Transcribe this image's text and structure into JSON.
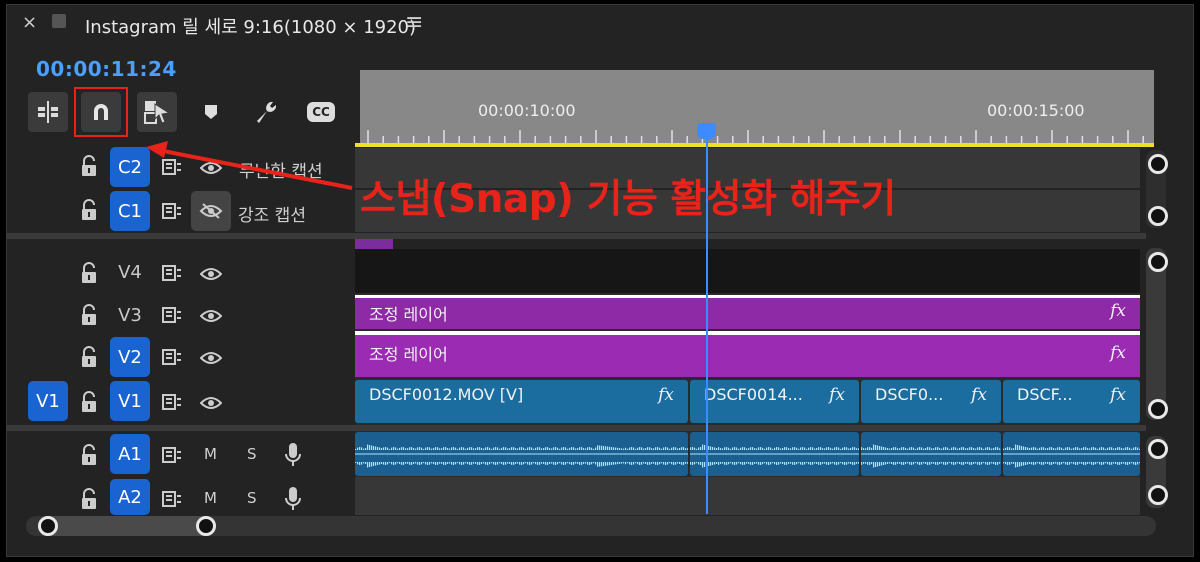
{
  "sequence": {
    "close_glyph": "×",
    "title": "Instagram 릴 세로 9:16(1080 × 1920)",
    "menu_glyph": "≡"
  },
  "timecode": "00:00:11:24",
  "ruler": {
    "labels": [
      "00:00:10:00",
      "00:00:15:00"
    ]
  },
  "toolbar": {
    "icons": [
      "insert-ripple-icon",
      "snap-magnet-icon",
      "linked-selection-icon",
      "marker-icon",
      "wrench-icon",
      "captions-icon"
    ],
    "captions_label": "CC"
  },
  "tracks": {
    "c2": {
      "id": "C2",
      "name": "무난한 캡션"
    },
    "c1": {
      "id": "C1",
      "name": "강조 캡션"
    },
    "v4": {
      "id": "V4"
    },
    "v3": {
      "id": "V3"
    },
    "v2": {
      "id": "V2"
    },
    "v1": {
      "id": "V1",
      "source": "V1"
    },
    "a1": {
      "id": "A1",
      "mute": "M",
      "solo": "S"
    },
    "a2": {
      "id": "A2",
      "mute": "M",
      "solo": "S"
    }
  },
  "clips": {
    "v3": {
      "label": "조정 레이어",
      "fx": "fx"
    },
    "v2": {
      "label": "조정 레이어",
      "fx": "fx"
    },
    "v1": [
      {
        "label": "DSCF0012.MOV [V]",
        "fx": "fx"
      },
      {
        "label": "DSCF0014...",
        "fx": "fx"
      },
      {
        "label": "DSCF0...",
        "fx": "fx"
      },
      {
        "label": "DSCF...",
        "fx": "fx"
      }
    ]
  },
  "annotation": {
    "text": "스냅(Snap) 기능 활성화 해주기",
    "color": "#e8231a"
  },
  "colors": {
    "accent_blue": "#1a64d2",
    "timecode_blue": "#4a9fff",
    "adjustment_purple": "#9b27b0",
    "video_clip_blue": "#1b6da0",
    "audio_clip_blue": "#1a5f8f",
    "work_area_yellow": "#f0e020"
  }
}
